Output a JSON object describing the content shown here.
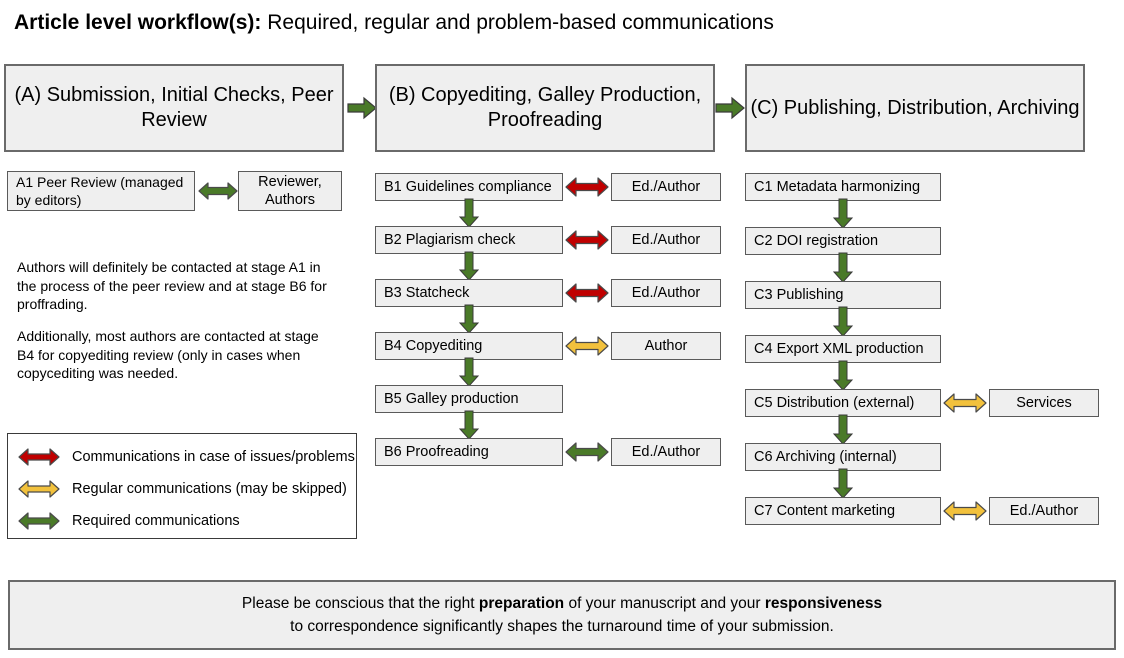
{
  "title": {
    "bold": "Article level workflow(s):",
    "rest": " Required, regular and problem-based communications"
  },
  "headers": [
    {
      "id": "A",
      "label": "(A) Submission, Initial Checks, Peer Review"
    },
    {
      "id": "B",
      "label": "(B) Copyediting, Galley Production, Proofreading"
    },
    {
      "id": "C",
      "label": "(C) Publishing, Distribution, Archiving"
    }
  ],
  "header_arrows": [
    {
      "name": "arrow-a-to-b",
      "direction": "right",
      "color": "#4a7a28"
    },
    {
      "name": "arrow-b-to-c",
      "direction": "right",
      "color": "#4a7a28"
    }
  ],
  "column_a": {
    "stage": {
      "label": "A1 Peer Review (managed by editors)"
    },
    "party": {
      "label": "Reviewer, Authors"
    },
    "link": {
      "color": "#4a7a28",
      "type": "Required communications"
    },
    "notes": [
      "Authors will definitely be contacted at stage A1 in the process of the peer review and at stage B6 for proffrading.",
      "Additionally, most authors are contacted at stage B4 for copyediting review (only in cases when copycediting was needed."
    ]
  },
  "column_b": {
    "rows": [
      {
        "stage": "B1 Guidelines compliance",
        "party": "Ed./Author",
        "link_color": "#c00000",
        "link_type": "problem"
      },
      {
        "stage": "B2 Plagiarism check",
        "party": "Ed./Author",
        "link_color": "#c00000",
        "link_type": "problem"
      },
      {
        "stage": "B3 Statcheck",
        "party": "Ed./Author",
        "link_color": "#c00000",
        "link_type": "problem"
      },
      {
        "stage": "B4 Copyediting",
        "party": "Author",
        "link_color": "#f2c13c",
        "link_type": "regular"
      },
      {
        "stage": "B5 Galley production",
        "party": null,
        "link_color": null,
        "link_type": null
      },
      {
        "stage": "B6 Proofreading",
        "party": "Ed./Author",
        "link_color": "#4a7a28",
        "link_type": "required"
      }
    ]
  },
  "column_c": {
    "rows": [
      {
        "stage": "C1 Metadata harmonizing",
        "party": null,
        "link_color": null,
        "link_type": null
      },
      {
        "stage": "C2 DOI registration",
        "party": null,
        "link_color": null,
        "link_type": null
      },
      {
        "stage": "C3 Publishing",
        "party": null,
        "link_color": null,
        "link_type": null
      },
      {
        "stage": "C4 Export XML production",
        "party": null,
        "link_color": null,
        "link_type": null
      },
      {
        "stage": "C5 Distribution (external)",
        "party": "Services",
        "link_color": "#f2c13c",
        "link_type": "regular"
      },
      {
        "stage": "C6 Archiving (internal)",
        "party": null,
        "link_color": null,
        "link_type": null
      },
      {
        "stage": "C7 Content marketing",
        "party": "Ed./Author",
        "link_color": "#f2c13c",
        "link_type": "regular"
      }
    ]
  },
  "legend": {
    "items": [
      {
        "color": "#c00000",
        "label": "Communications in case of issues/problems"
      },
      {
        "color": "#f2c13c",
        "label": "Regular communications (may be skipped)"
      },
      {
        "color": "#4a7a28",
        "label": "Required communications"
      }
    ]
  },
  "footer": {
    "part1": "Please be conscious that the right ",
    "bold1": "preparation",
    "part2": " of your manuscript and your ",
    "bold2": "responsiveness",
    "part3": "to correspondence significantly shapes the turnaround time of your submission."
  },
  "colors": {
    "green": "#4a7a28",
    "red": "#c00000",
    "yellow": "#f2c13c",
    "box_fill": "#efefef",
    "box_border": "#5a5a5a",
    "arrow_outline": "#4a4a4a"
  }
}
